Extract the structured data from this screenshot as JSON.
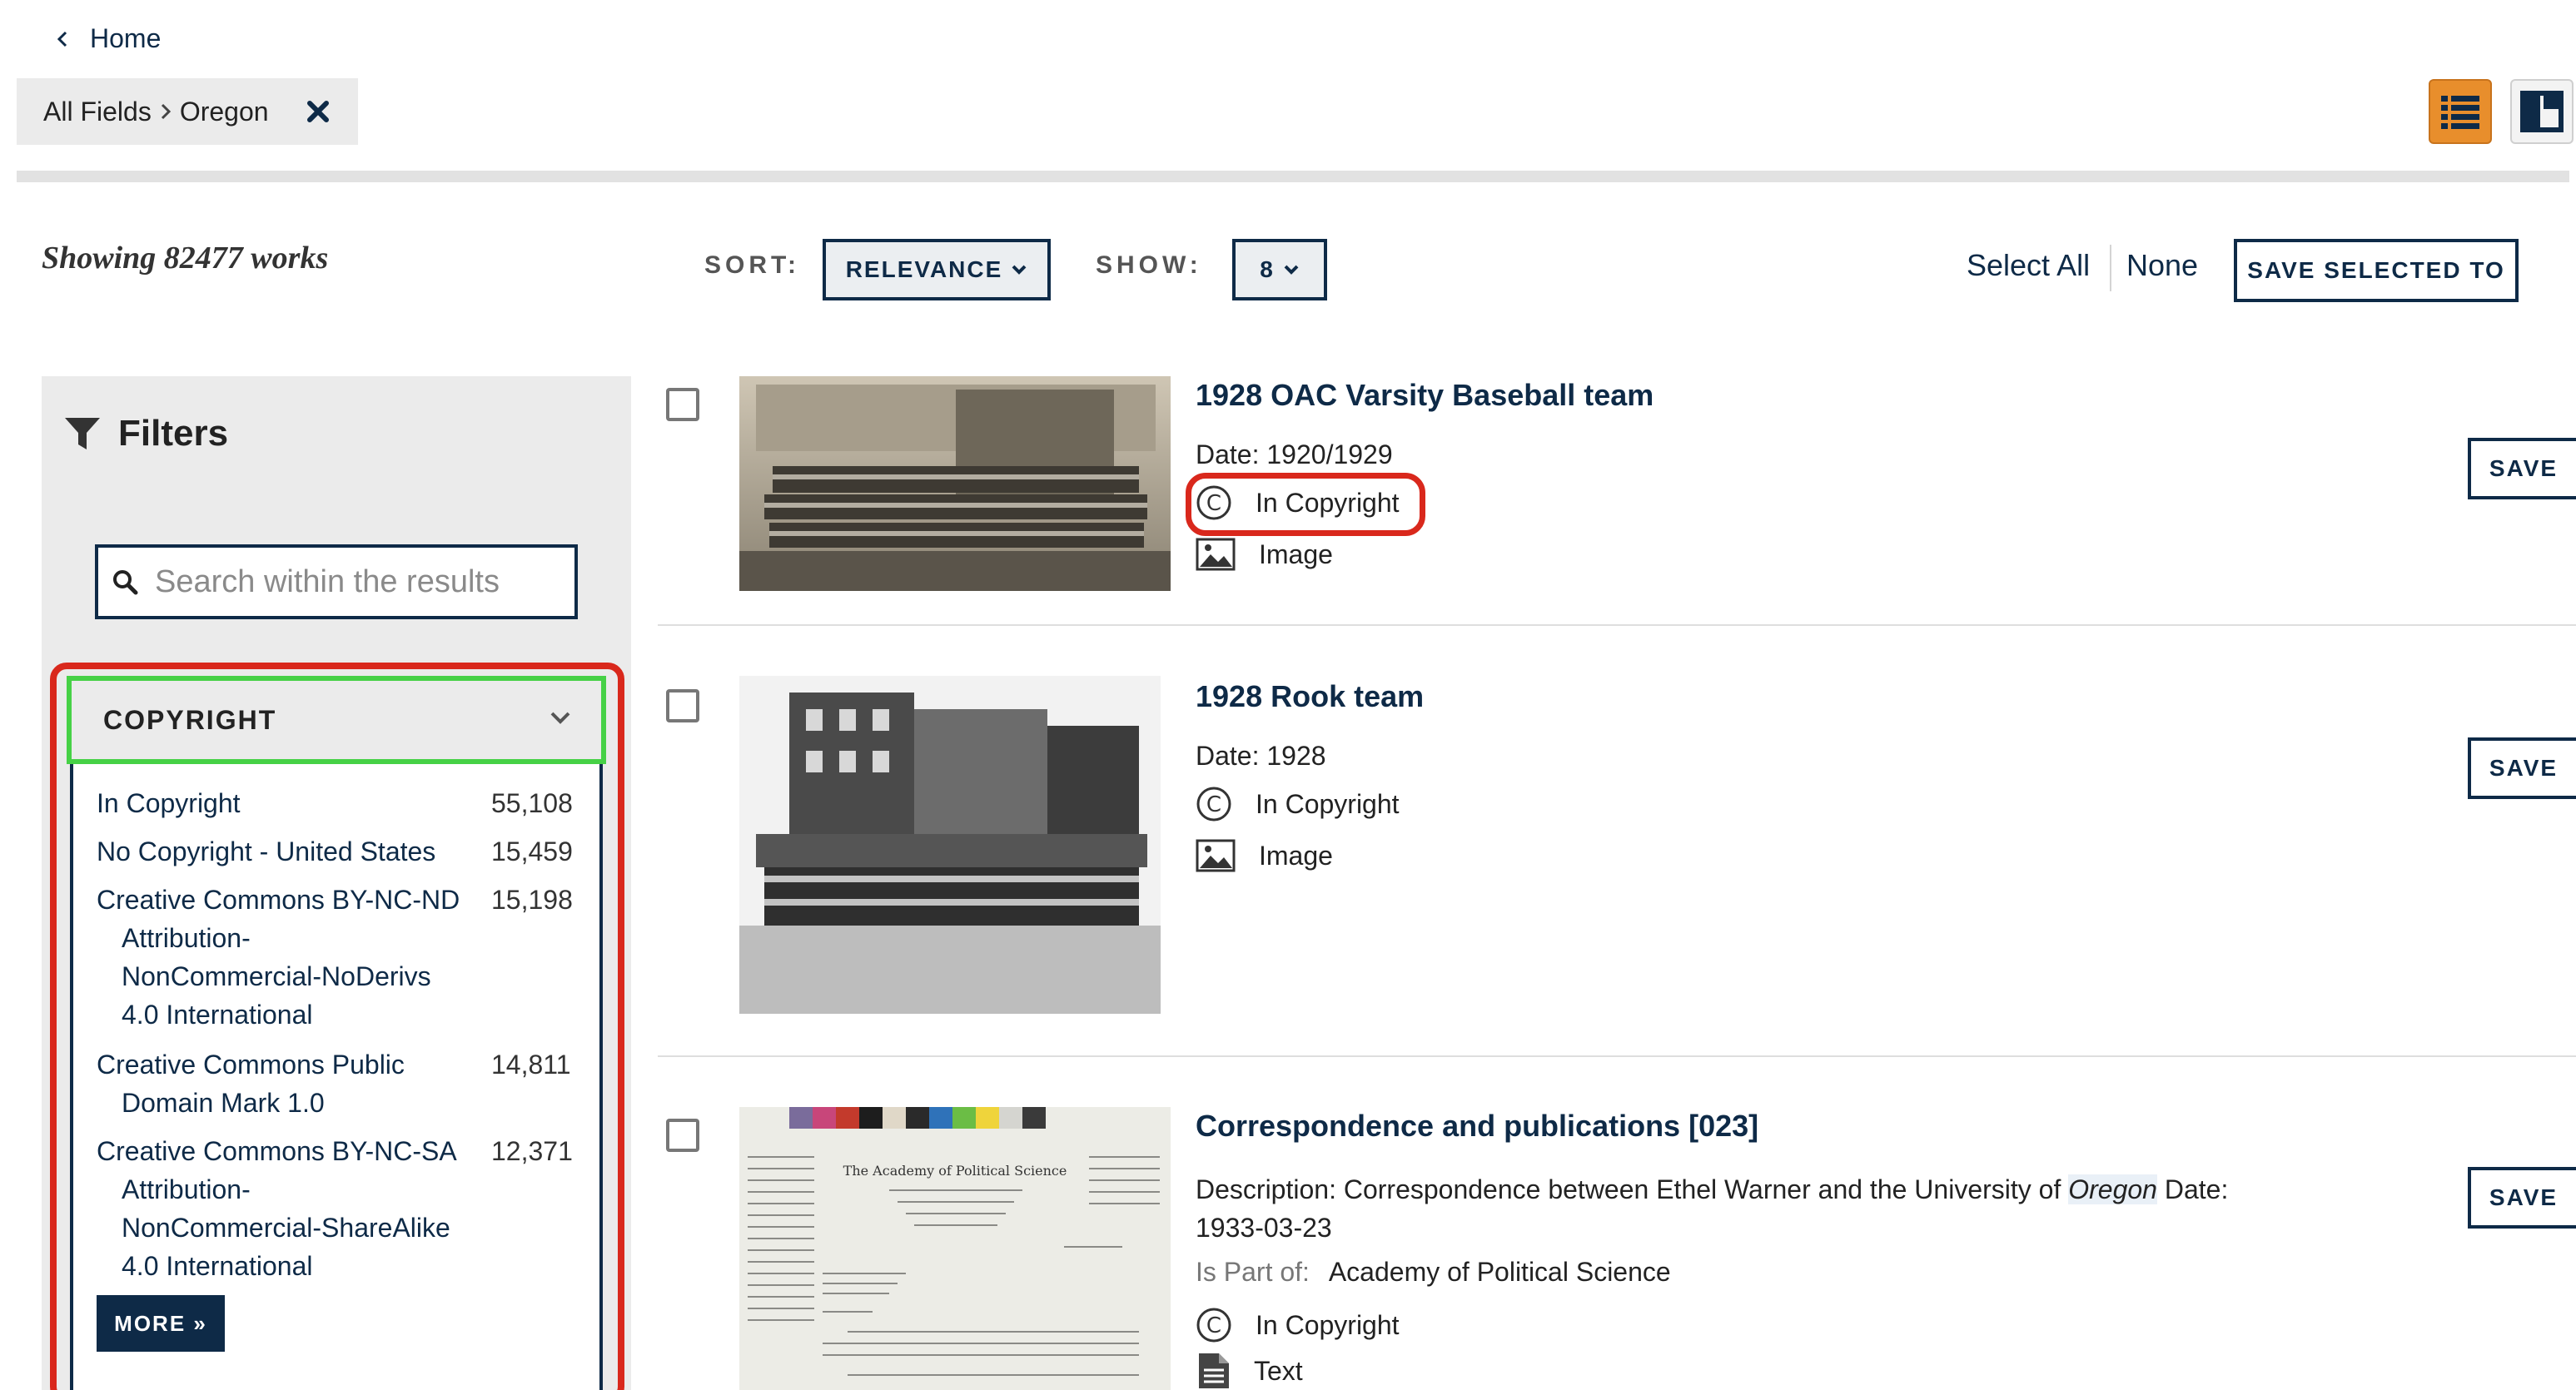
{
  "nav": {
    "home_label": "Home"
  },
  "breadcrumb": {
    "field": "All Fields",
    "value": "Oregon"
  },
  "toolbar": {
    "showing": "Showing 82477 works",
    "sort_label": "SORT:",
    "sort_value": "RELEVANCE",
    "show_label": "SHOW:",
    "show_value": "8",
    "select_all": "Select All",
    "none": "None",
    "save_selected": "SAVE SELECTED TO"
  },
  "sidebar": {
    "title": "Filters",
    "search_placeholder": "Search within the results",
    "facet": {
      "title": "COPYRIGHT",
      "items": [
        {
          "line1": "In Copyright",
          "rest": [],
          "count": "55,108"
        },
        {
          "line1": "No Copyright - United States",
          "rest": [],
          "count": "15,459"
        },
        {
          "line1": "Creative Commons BY-NC-ND",
          "rest": [
            "Attribution-",
            "NonCommercial-NoDerivs",
            "4.0 International"
          ],
          "count": "15,198"
        },
        {
          "line1": "Creative Commons Public",
          "rest": [
            "Domain Mark 1.0"
          ],
          "count": "14,811"
        },
        {
          "line1": "Creative Commons BY-NC-SA",
          "rest": [
            "Attribution-",
            "NonCommercial-ShareAlike",
            "4.0 International"
          ],
          "count": "12,371"
        }
      ],
      "more_label": "MORE »"
    }
  },
  "results": [
    {
      "title": "1928 OAC Varsity Baseball team",
      "date": "Date: 1920/1929",
      "rights": "In Copyright",
      "type": "Image",
      "save": "SAVE"
    },
    {
      "title": "1928 Rook team",
      "date": "Date: 1928",
      "rights": "In Copyright",
      "type": "Image",
      "save": "SAVE"
    },
    {
      "title": "Correspondence and publications [023]",
      "description_before": "Description: Correspondence between Ethel Warner and the University of ",
      "description_highlight": "Oregon",
      "description_after": " Date:",
      "description_line2": "1933-03-23",
      "part_of_label": "Is Part of:",
      "part_of_value": "Academy of Political Science",
      "rights": "In Copyright",
      "type": "Text",
      "save": "SAVE",
      "letter_heading": "The Academy of Political Science"
    }
  ],
  "colors": {
    "navy": "#0e2a47",
    "accent_orange": "#e88e2c",
    "highlight_red": "#d9281c",
    "highlight_green": "#46d146"
  }
}
